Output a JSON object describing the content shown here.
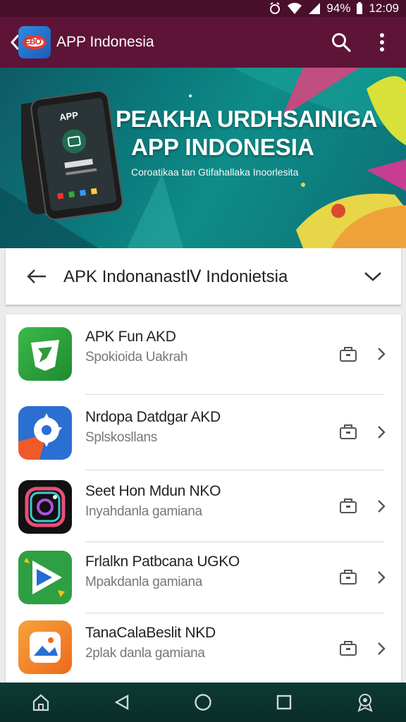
{
  "status_bar": {
    "battery": "94%",
    "time": "12:09"
  },
  "app_bar": {
    "title": "APP Indonesia",
    "logo_text": "EBO"
  },
  "banner": {
    "phone_text": "APP",
    "title_line1": "PEAKHA URDHSAINIGA",
    "title_line2": "APP INDONESIA",
    "subtitle": "Coroatikaa tan Gtifahallaka Inoorlesita"
  },
  "selector": {
    "label": "APK IndonanastⅣ Indonietsia"
  },
  "apps": [
    {
      "title": "APK Fun AKD",
      "subtitle": "Spokioida Uakrah",
      "icon": "shield-app-icon",
      "color": "#2e9a3c"
    },
    {
      "title": "Nrdopa Datdgar AKD",
      "subtitle": "Splskosllans",
      "icon": "gear-app-icon",
      "color": "#2a6fd1"
    },
    {
      "title": "Seet Hon Mdun NKO",
      "subtitle": "Inyahdanla gamiana",
      "icon": "camera-app-icon",
      "color": "#111111"
    },
    {
      "title": "Frlalkn Patbcana UGKO",
      "subtitle": "Mpakdanla gamiana",
      "icon": "play-app-icon",
      "color": "#2ea043"
    },
    {
      "title": "TanaCalaBeslit NKD",
      "subtitle": "2plak danla gamiana",
      "icon": "photo-app-icon",
      "color": "#f08a24"
    }
  ],
  "colors": {
    "status": "#4a0f2a",
    "app_bar": "#5e1436",
    "nav": "#0e3a34"
  }
}
